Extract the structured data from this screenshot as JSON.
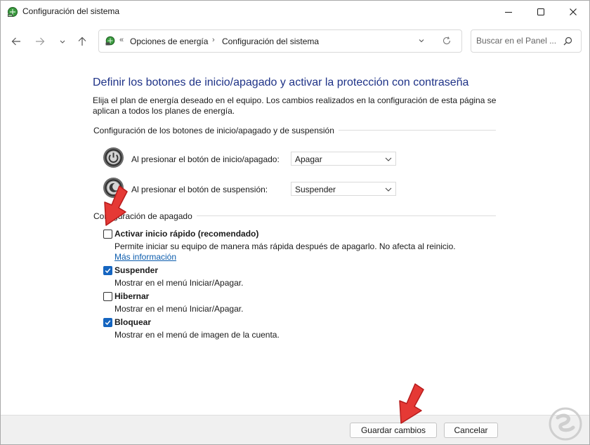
{
  "window": {
    "title": "Configuración del sistema"
  },
  "address_bar": {
    "overflow": "«",
    "crumbs": [
      "Opciones de energía",
      "Configuración del sistema"
    ],
    "search_placeholder": "Buscar en el Panel ..."
  },
  "page": {
    "title": "Definir los botones de inicio/apagado y activar la protección con contraseña",
    "description": "Elija el plan de energía deseado en el equipo. Los cambios realizados en la configuración de esta página se aplican a todos los planes de energía."
  },
  "buttons_group": {
    "title": "Configuración de los botones de inicio/apagado y de suspensión",
    "rows": [
      {
        "label": "Al presionar el botón de inicio/apagado:",
        "value": "Apagar",
        "icon": "power-button-icon"
      },
      {
        "label": "Al presionar el botón de suspensión:",
        "value": "Suspender",
        "icon": "sleep-button-icon"
      }
    ]
  },
  "shutdown_group": {
    "title": "Configuración de apagado",
    "options": [
      {
        "label": "Activar inicio rápido (recomendado)",
        "checked": false,
        "desc": "Permite iniciar su equipo de manera más rápida después de apagarlo. No afecta al reinicio.",
        "link": "Más información"
      },
      {
        "label": "Suspender",
        "checked": true,
        "desc": "Mostrar en el menú Iniciar/Apagar."
      },
      {
        "label": "Hibernar",
        "checked": false,
        "desc": "Mostrar en el menú Iniciar/Apagar."
      },
      {
        "label": "Bloquear",
        "checked": true,
        "desc": "Mostrar en el menú de imagen de la cuenta."
      }
    ]
  },
  "footer": {
    "save": "Guardar cambios",
    "cancel": "Cancelar"
  },
  "colors": {
    "accent": "#1565c0",
    "title": "#1e3287",
    "link": "#0b5cad",
    "annotation_arrow": "#e53935"
  }
}
